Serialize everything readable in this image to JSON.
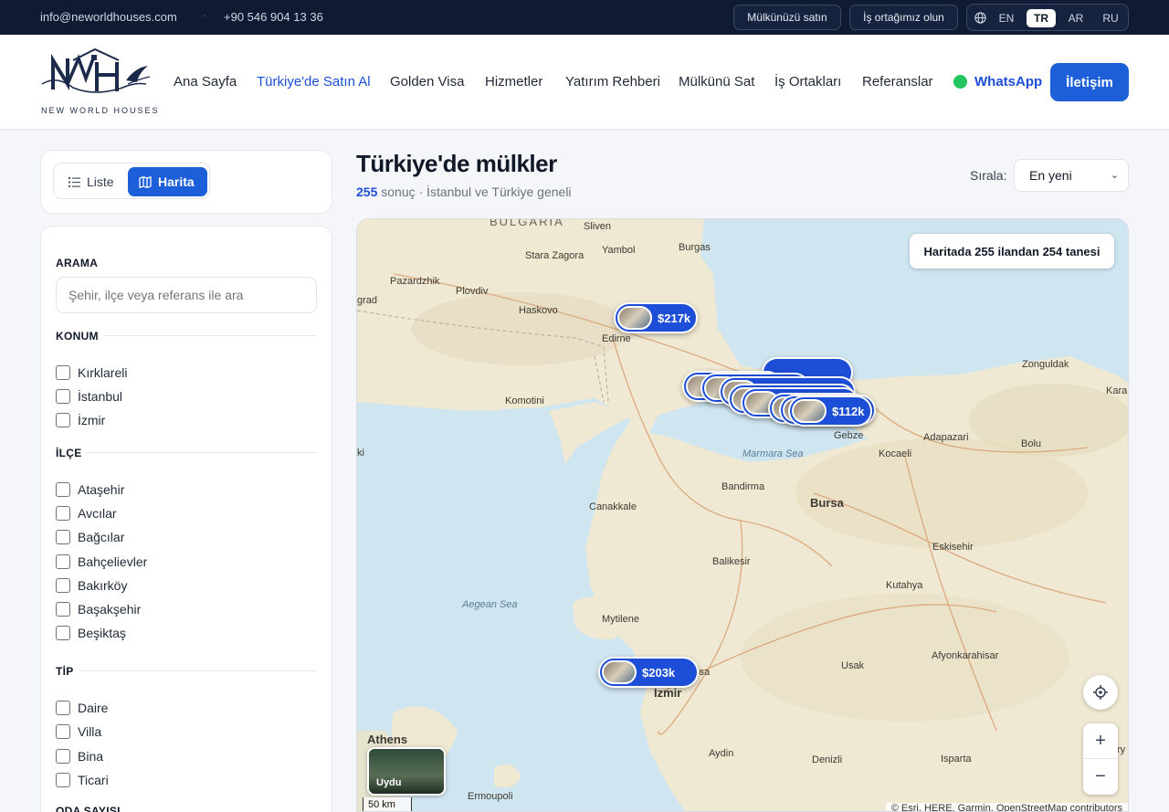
{
  "topbar": {
    "email": "info@neworldhouses.com",
    "separator": "·",
    "phone": "+90 546 904 13 36",
    "buttons": [
      "Mülkünüzü satın",
      "İş ortağımız olun"
    ],
    "languages": [
      "EN",
      "TR",
      "AR",
      "RU"
    ],
    "active_language": "TR"
  },
  "header": {
    "logo_text": "NEW WORLD HOUSES",
    "nav": [
      "Ana Sayfa",
      "Türkiye'de Satın Al",
      "Golden Visa",
      "Hizmetler",
      "Yatırım Rehberi",
      "Mülkünü Sat",
      "İş Ortakları",
      "Referanslar"
    ],
    "active_nav": "Türkiye'de Satın Al",
    "whatsapp": "WhatsApp",
    "contact": "İletişim"
  },
  "view_toggle": {
    "list": "Liste",
    "map": "Harita",
    "active": "Harita"
  },
  "filters": {
    "search_title": "ARAMA",
    "search_placeholder": "Şehir, ilçe veya referans ile ara",
    "location_title": "KONUM",
    "locations": [
      "Kırklareli",
      "İstanbul",
      "İzmir"
    ],
    "district_title": "İLÇE",
    "districts": [
      "Ataşehir",
      "Avcılar",
      "Bağcılar",
      "Bahçelievler",
      "Bakırköy",
      "Başakşehir",
      "Beşiktaş"
    ],
    "type_title": "TİP",
    "types": [
      "Daire",
      "Villa",
      "Bina",
      "Ticari"
    ],
    "rooms_title": "ODA SAYISI"
  },
  "main": {
    "title": "Türkiye'de mülkler",
    "count": "255",
    "subtitle_rest": " sonuç · İstanbul ve Türkiye geneli",
    "sort_label": "Sırala:",
    "sort_value": "En yeni"
  },
  "map": {
    "info": "Haritada 255 ilandan 254 tanesi",
    "pins": [
      "$217k",
      "$112k",
      "$203k"
    ],
    "satellite": "Uydu",
    "scale": "50 km",
    "attribution": "© Esri, HERE, Garmin, OpenStreetMap contributors",
    "labels": [
      "BULGARIA",
      "Sliven",
      "Yambol",
      "Burgas",
      "Stara Zagora",
      "Pazardzhik",
      "Plovdiv",
      "Haskovo",
      "Edirne",
      "Komotini",
      "Zonguldak",
      "Marmara Sea",
      "Gebze",
      "Kocaeli",
      "Adapazari",
      "Bolu",
      "Bandirma",
      "Bursa",
      "Canakkale",
      "Eskisehir",
      "Balikesir",
      "Kutahya",
      "Aegean Sea",
      "Mytilene",
      "Afyonkarahisar",
      "Usak",
      "Izmir",
      "Athens",
      "Aydin",
      "Denizli",
      "Isparta",
      "Ermoupoli",
      "grad",
      "Kara",
      "ki",
      "isa",
      "ry"
    ],
    "colors": {
      "land": "#f1ecd9",
      "sea": "#cfe5f0",
      "pin": "#1d4ed8"
    }
  }
}
